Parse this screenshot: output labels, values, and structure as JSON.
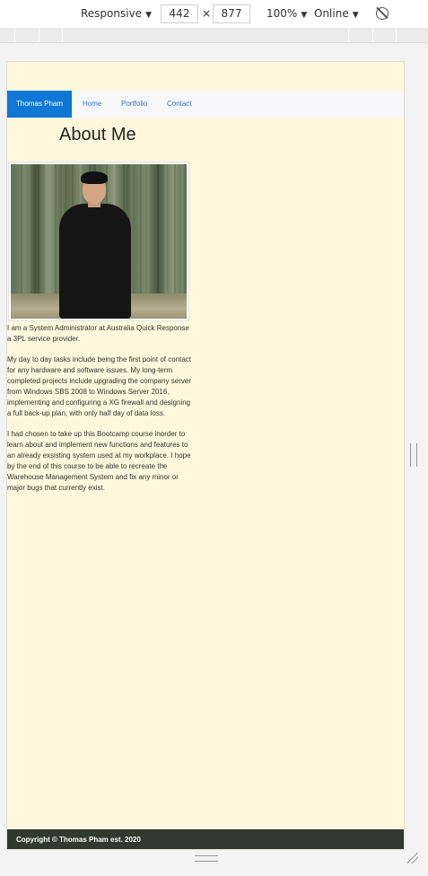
{
  "devtools": {
    "device": "Responsive",
    "width": "442",
    "times": "×",
    "height": "877",
    "zoom": "100%",
    "throttle": "Online",
    "caret": "▼"
  },
  "page": {
    "navbar": {
      "brand": "Thomas Pham",
      "links": [
        "Home",
        "Portfolio",
        "Contact"
      ]
    },
    "title": "About Me",
    "paragraphs": [
      "I am a System Administrator at Australia Quick Response a 3PL service provider.",
      "My day to day tasks include being the first point of contact for any hardware and software issues. My long-term completed projects include upgrading the company server from Windows SBS 2008 to Windows Server 2016, implementing and configuring a XG firewall and designing a full back-up plan, with only half day of data loss.",
      "I had chosen to take up this Bootcamp course inorder to learn about and implement new functions and features to an already exsisting system used at my workplace. I hope by the end of this course to be able to recreate the Warehouse Management System and fix any minor or major bugs that currently exist."
    ],
    "footer": "Copyright © Thomas Pham est. 2020"
  }
}
